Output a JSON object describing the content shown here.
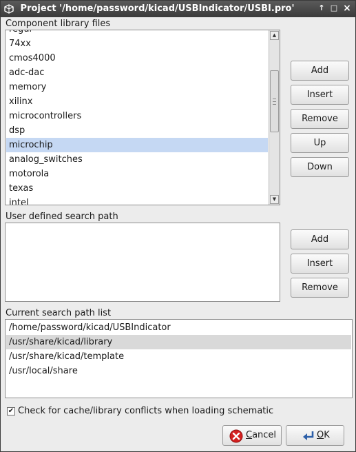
{
  "window": {
    "title": "Project '/home/password/kicad/USBIndicator/USBI.pro'",
    "controls": [
      "↑",
      "□",
      "×"
    ]
  },
  "component_libs": {
    "label": "Component library files",
    "items": [
      "regul",
      "74xx",
      "cmos4000",
      "adc-dac",
      "memory",
      "xilinx",
      "microcontrollers",
      "dsp",
      "microchip",
      "analog_switches",
      "motorola",
      "texas",
      "intel"
    ],
    "selected": "microchip"
  },
  "component_buttons": {
    "add": "Add",
    "insert": "Insert",
    "remove": "Remove",
    "up": "Up",
    "down": "Down"
  },
  "user_path": {
    "label": "User defined search path",
    "buttons": {
      "add": "Add",
      "insert": "Insert",
      "remove": "Remove"
    }
  },
  "current_path": {
    "label": "Current search path list",
    "items": [
      "/home/password/kicad/USBIndicator",
      "/usr/share/kicad/library",
      "/usr/share/kicad/template",
      "/usr/local/share"
    ],
    "selected": "/usr/share/kicad/library"
  },
  "cache_check": {
    "label": "Check for cache/library conflicts when loading schematic",
    "checked": true,
    "mark": "✔"
  },
  "footer": {
    "cancel": "Cancel",
    "ok": "OK"
  },
  "colors": {
    "selection_blue": "#c5d8f3",
    "selection_grey": "#d9d9d9",
    "cancel_red": "#d42020"
  }
}
